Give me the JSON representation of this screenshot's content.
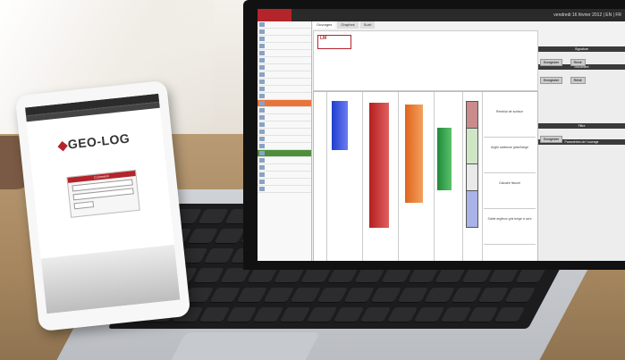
{
  "tablet": {
    "brand": "GEO-LOG",
    "login_header": "Connexion"
  },
  "laptop": {
    "topbar_date": "vendredi 16 février 2012 | EN | FR",
    "tabs": [
      "Ouvrages",
      "Graphes",
      "Suivi"
    ],
    "descriptions": [
      "Remblai de surface",
      "Argile sableuse grise/beige",
      "Calcaire fissuré",
      "Sable argileux gris beige à ocre"
    ],
    "panel_headings": [
      "Signature",
      "Document",
      "Filtre",
      "Paramètres de l'ouvrage"
    ],
    "panel_buttons": [
      "Enregistrer",
      "Réinit"
    ]
  },
  "colors": {
    "brand_red": "#b3242b",
    "curve_blue": "#1f3fd0",
    "curve_red": "#b51f1f",
    "curve_orange": "#e0641b",
    "curve_green": "#1f8a3c",
    "selection_orange": "#e9743a"
  }
}
